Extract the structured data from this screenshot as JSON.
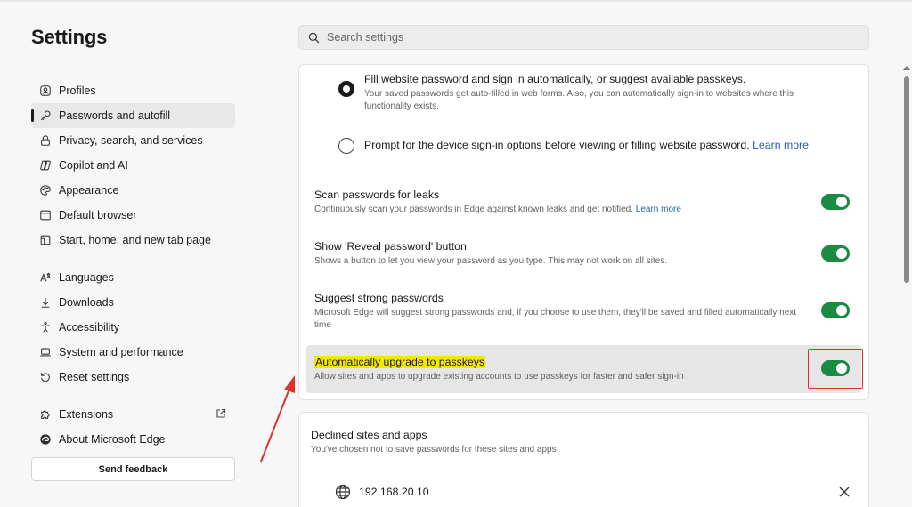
{
  "app": {
    "title": "Settings"
  },
  "search": {
    "placeholder": "Search settings"
  },
  "sidebar": {
    "items": [
      {
        "label": "Profiles",
        "icon": "profile-icon"
      },
      {
        "label": "Passwords and autofill",
        "icon": "key-icon",
        "active": true
      },
      {
        "label": "Privacy, search, and services",
        "icon": "lock-icon"
      },
      {
        "label": "Copilot and AI",
        "icon": "copilot-icon"
      },
      {
        "label": "Appearance",
        "icon": "palette-icon"
      },
      {
        "label": "Default browser",
        "icon": "browser-icon"
      },
      {
        "label": "Start, home, and new tab page",
        "icon": "home-icon"
      },
      {
        "label": "Languages",
        "icon": "languages-icon"
      },
      {
        "label": "Downloads",
        "icon": "download-icon"
      },
      {
        "label": "Accessibility",
        "icon": "accessibility-icon"
      },
      {
        "label": "System and performance",
        "icon": "laptop-icon"
      },
      {
        "label": "Reset settings",
        "icon": "reset-icon"
      },
      {
        "label": "Extensions",
        "icon": "puzzle-icon"
      },
      {
        "label": "About Microsoft Edge",
        "icon": "edge-logo-icon"
      }
    ],
    "feedback_label": "Send feedback"
  },
  "autofill": {
    "option1": {
      "label": "Fill website password and sign in automatically, or suggest available passkeys.",
      "desc": "Your saved passwords get auto-filled in web forms. Also, you can automatically sign-in to websites where this functionality exists.",
      "checked": true
    },
    "option2": {
      "label": "Prompt for the device sign-in options before viewing or filling website password.",
      "link": "Learn more",
      "checked": false
    }
  },
  "settings": [
    {
      "label": "Scan passwords for leaks",
      "desc": "Continuously scan your passwords in Edge against known leaks and get notified.",
      "link": "Learn more",
      "on": true
    },
    {
      "label": "Show 'Reveal password' button",
      "desc": "Shows a button to let you view your password as you type. This may not work on all sites.",
      "on": true
    },
    {
      "label": "Suggest strong passwords",
      "desc": "Microsoft Edge will suggest strong passwords and, if you choose to use them, they'll be saved and filled automatically next time",
      "on": true
    },
    {
      "label": "Automatically upgrade to passkeys",
      "desc": "Allow sites and apps to upgrade existing accounts to use passkeys for faster and safer sign-in",
      "on": true
    }
  ],
  "declined": {
    "title": "Declined sites and apps",
    "subtitle": "You've chosen not to save passwords for these sites and apps",
    "sites": [
      {
        "host": "192.168.20.10"
      }
    ]
  },
  "colors": {
    "toggle_on": "#1b8a43",
    "link": "#1f5fb8",
    "highlight": "#f5e800",
    "annotation": "#e0302a"
  }
}
